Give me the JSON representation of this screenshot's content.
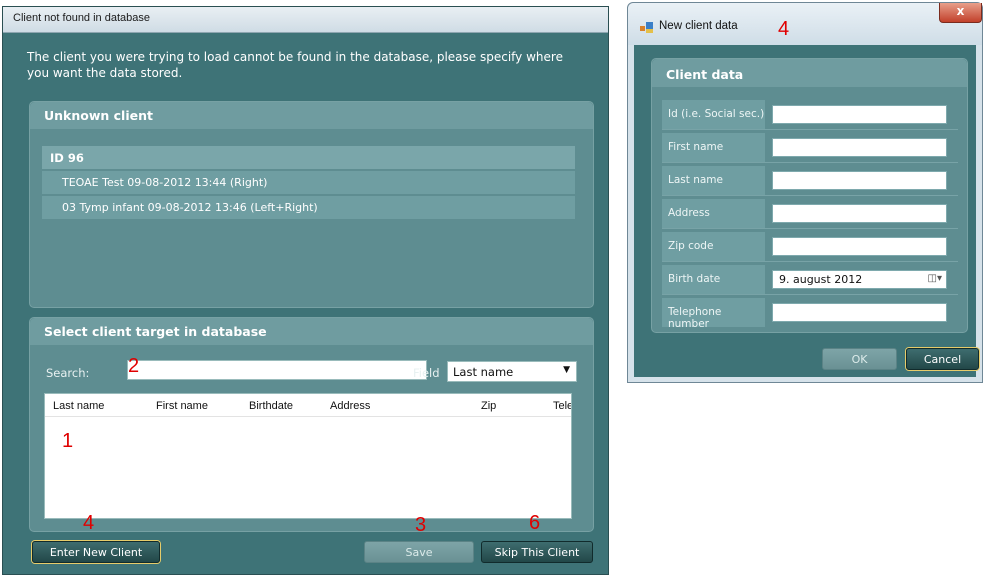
{
  "left_dialog": {
    "title": "Client not found in database",
    "intro_text": "The client you were trying to load cannot be found in the database, please specify where you want the data stored.",
    "unknown_client": {
      "header": "Unknown client",
      "id_label": "ID 96",
      "tests": [
        "TEOAE Test 09-08-2012 13:44 (Right)",
        "03 Tymp infant 09-08-2012 13:46 (Left+Right)"
      ]
    },
    "target": {
      "header": "Select client target in database",
      "search_label": "Search:",
      "search_value": "",
      "field_label": "Field",
      "field_value": "Last name",
      "columns": [
        "Last name",
        "First name",
        "Birthdate",
        "Address",
        "Zip",
        "Tele"
      ]
    },
    "buttons": {
      "enter_new_client": "Enter New Client",
      "save": "Save",
      "skip": "Skip This Client"
    }
  },
  "annotations": {
    "a1": "1",
    "a2": "2",
    "a3": "3",
    "a4_left": "4",
    "a4_right": "4",
    "a6": "6"
  },
  "right_dialog": {
    "title": "New client data",
    "close_label": "x",
    "panel_header": "Client data",
    "fields": [
      {
        "label": "Id (i.e. Social sec.)",
        "value": ""
      },
      {
        "label": "First name",
        "value": ""
      },
      {
        "label": "Last name",
        "value": ""
      },
      {
        "label": "Address",
        "value": ""
      },
      {
        "label": "Zip code",
        "value": ""
      },
      {
        "label": "Birth date",
        "value": "9.   august   2012"
      },
      {
        "label": "Telephone number",
        "value": ""
      }
    ],
    "ok_label": "OK",
    "cancel_label": "Cancel"
  },
  "colors": {
    "dialog_bg": "#3e7377",
    "panel_bg": "#5e8d91",
    "annotation_red": "#e00000",
    "focus_outline": "#e6cc6a"
  }
}
